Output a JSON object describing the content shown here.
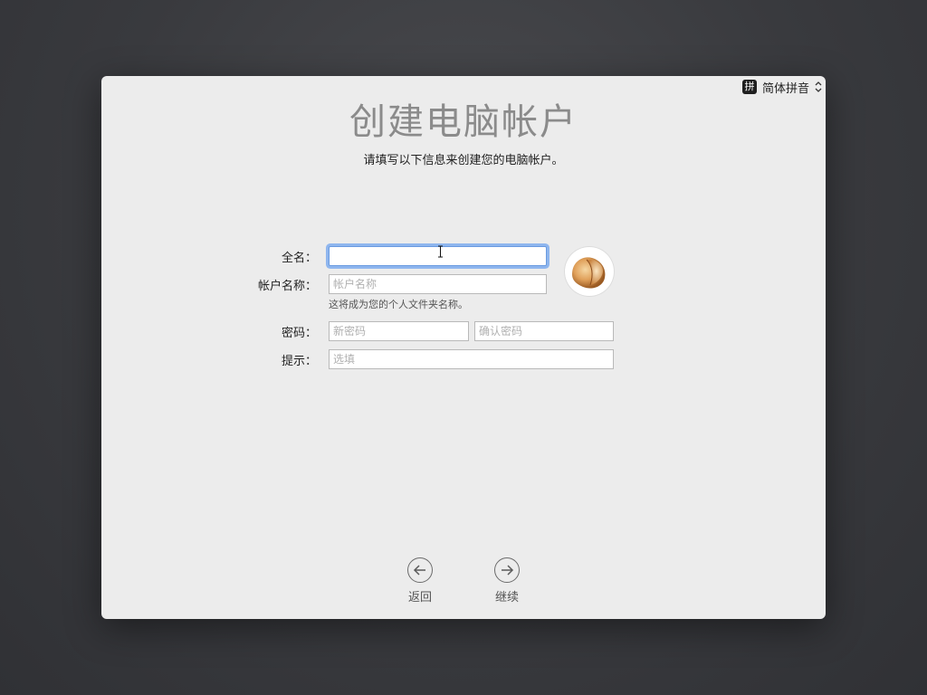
{
  "input_source": {
    "icon_glyph": "拼",
    "label": "简体拼音",
    "icon": "pinyin-input-icon"
  },
  "header": {
    "title": "创建电脑帐户",
    "subtitle": "请填写以下信息来创建您的电脑帐户。"
  },
  "form": {
    "full_name": {
      "label": "全名：",
      "value": "",
      "placeholder": ""
    },
    "account_name": {
      "label": "帐户名称：",
      "value": "",
      "placeholder": "帐户名称",
      "hint": "这将成为您的个人文件夹名称。"
    },
    "password": {
      "label": "密码：",
      "placeholder": "新密码",
      "confirm_placeholder": "确认密码"
    },
    "hint": {
      "label": "提示：",
      "placeholder": "选填"
    }
  },
  "avatar": {
    "icon": "fortune-cookie-avatar"
  },
  "buttons": {
    "back": {
      "label": "返回",
      "icon": "arrow-left-circle-icon"
    },
    "continue": {
      "label": "继续",
      "icon": "arrow-right-circle-icon"
    }
  },
  "colors": {
    "background": "#3a3b3f",
    "panel": "#ececec",
    "title": "#8b8b8b",
    "focus_ring": "#8fb6ee"
  }
}
